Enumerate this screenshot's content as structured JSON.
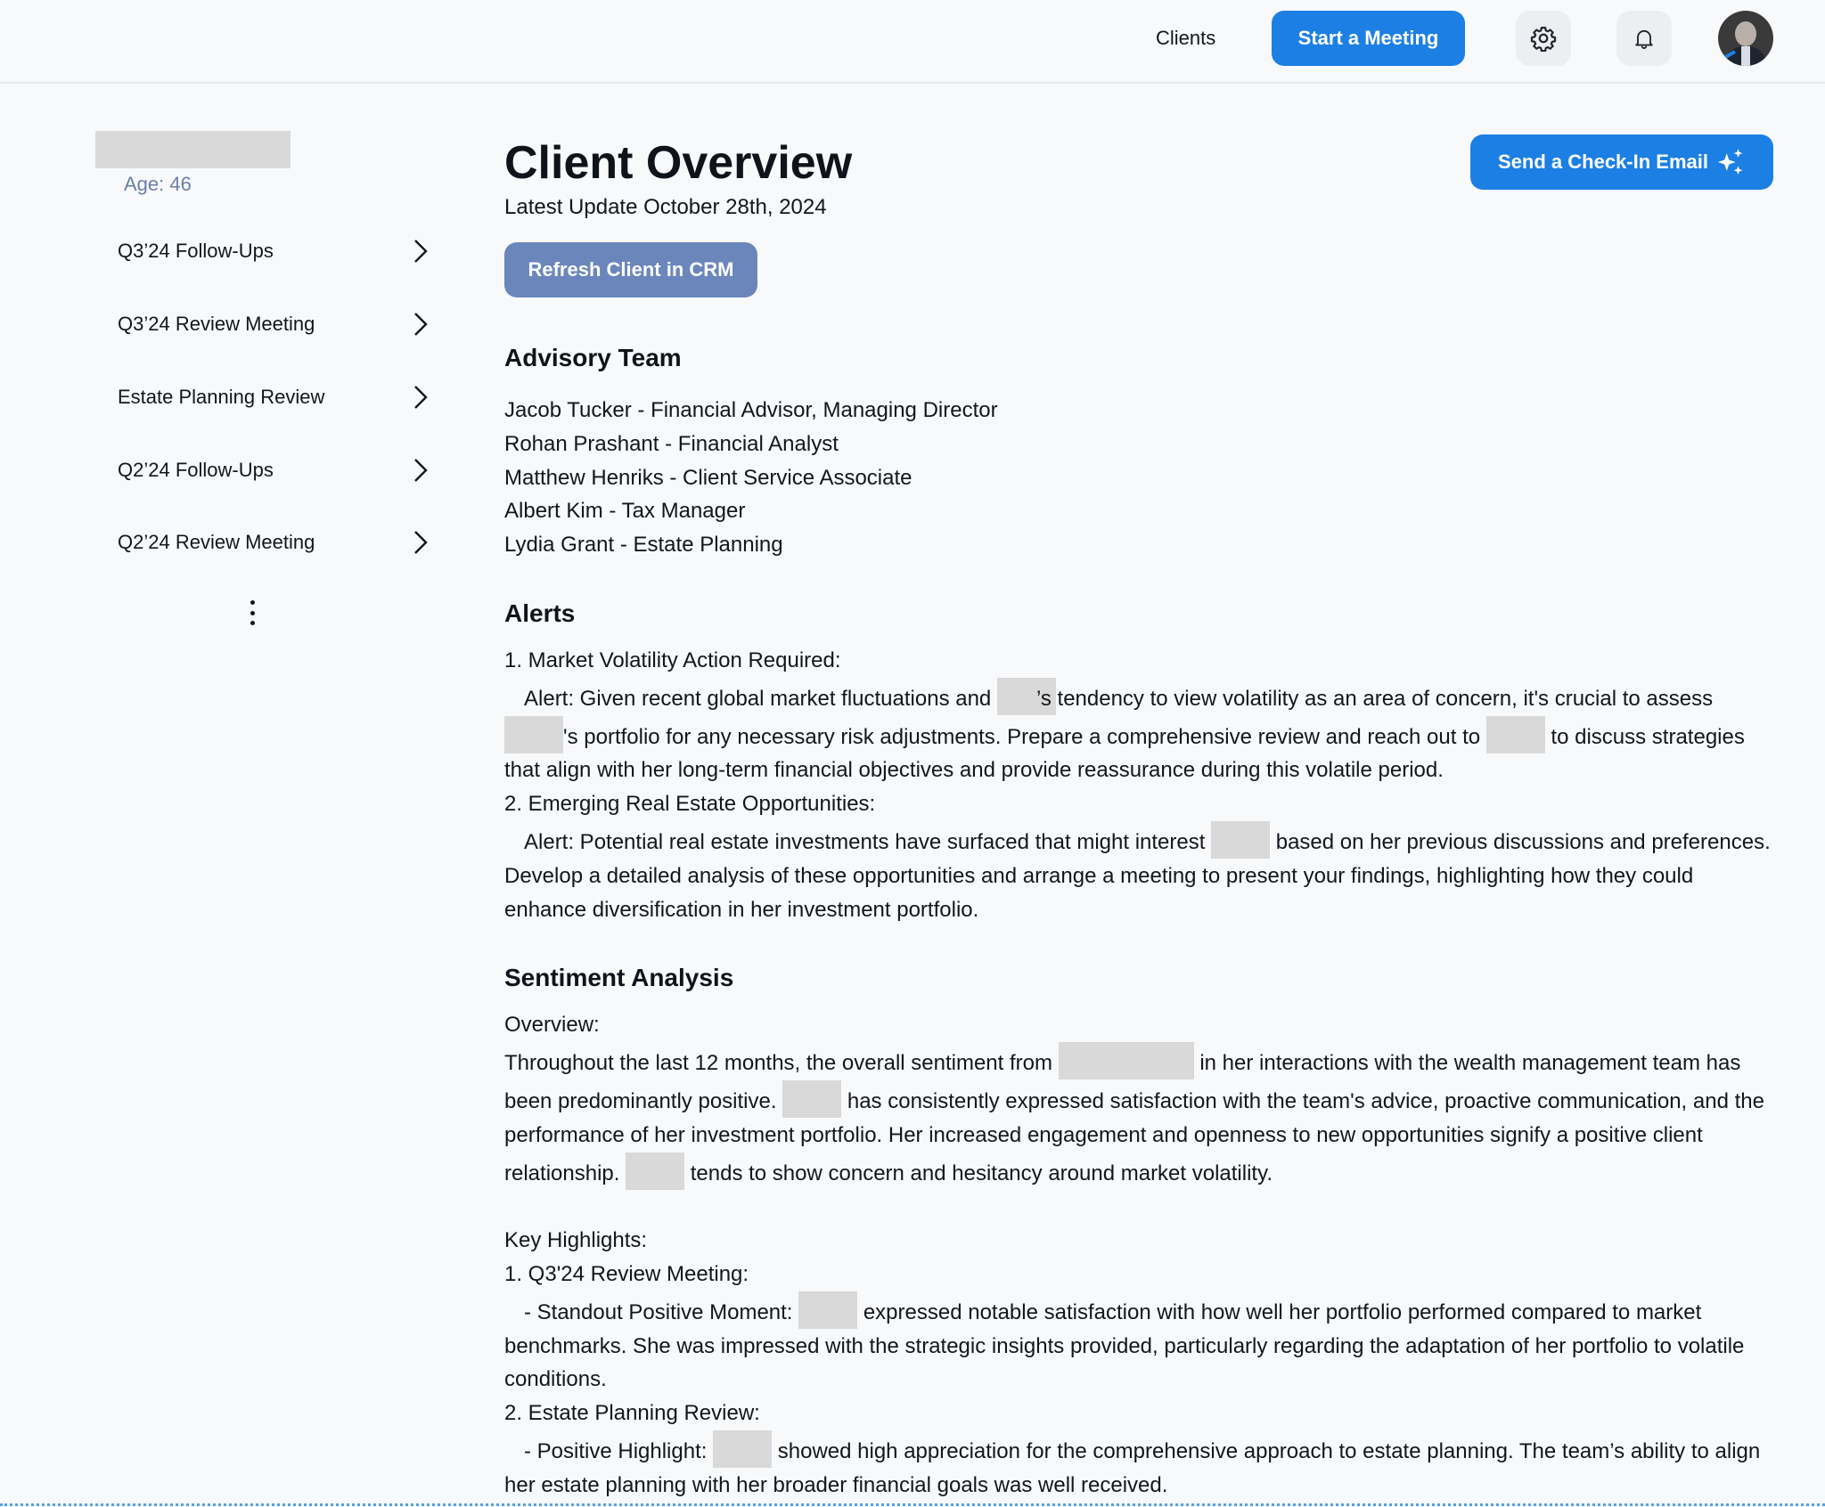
{
  "header": {
    "nav_clients": "Clients",
    "start_meeting_label": "Start a Meeting",
    "icons": {
      "settings": "gear-icon",
      "notifications": "bell-icon",
      "avatar": "user-avatar"
    },
    "colors": {
      "primary": "#1c7fe3",
      "icon_button_bg": "#eceef2"
    }
  },
  "sidebar": {
    "client_name": "",
    "age": "Age: 46",
    "items": [
      {
        "label": "Q3’24 Follow-Ups"
      },
      {
        "label": "Q3’24 Review Meeting"
      },
      {
        "label": "Estate Planning Review"
      },
      {
        "label": "Q2’24 Follow-Ups"
      },
      {
        "label": "Q2’24 Review Meeting"
      }
    ],
    "more_icon": "kebab-menu-icon"
  },
  "main": {
    "title": "Client Overview",
    "latest_update": "Latest Update October 28th, 2024",
    "refresh_label": "Refresh Client in CRM",
    "send_email_label": "Send a Check-In Email",
    "send_email_icon": "sparkles-icon",
    "colors": {
      "refresh_button": "#6b86bb",
      "send_button": "#1c7fe3"
    },
    "advisory_team": {
      "heading": "Advisory Team",
      "members": [
        "Jacob Tucker - Financial Advisor, Managing Director",
        "Rohan Prashant - Financial Analyst",
        "Matthew Henriks - Client Service Associate",
        "Albert Kim - Tax Manager",
        "Lydia Grant - Estate Planning"
      ]
    },
    "alerts": {
      "heading": "Alerts",
      "items": [
        {
          "title": "1. Market Volatility Action Required:",
          "t1": "Alert: Given recent global market fluctuations and ",
          "t2": "’s tendency to view volatility as an area of concern, it's crucial to assess ",
          "t3": "'s portfolio for any necessary risk adjustments. Prepare a comprehensive review and reach out to ",
          "t4": " to discuss strategies that align with her long-term financial objectives and provide reassurance during this volatile period."
        },
        {
          "title": "2. Emerging Real Estate Opportunities:",
          "t1": "Alert: Potential real estate investments have surfaced that might interest ",
          "t2": " based on her previous discussions and preferences. Develop a detailed analysis of these opportunities and arrange a meeting to present your findings, highlighting how they could enhance diversification in her investment portfolio."
        }
      ]
    },
    "sentiment": {
      "heading": "Sentiment Analysis",
      "overview_label": "Overview:",
      "o1": "Throughout the last 12 months, the overall sentiment from ",
      "o2": " in her interactions with the wealth management team has been predominantly positive. ",
      "o3": " has consistently expressed satisfaction with the team's advice, proactive communication, and the performance of her investment portfolio. Her increased engagement and openness to new opportunities signify a positive client relationship. ",
      "o4": " tends to show concern and hesitancy around market volatility.",
      "highlights_label": "Key Highlights:",
      "highlights": [
        {
          "title": "1. Q3'24 Review Meeting:",
          "t1": "- Standout Positive Moment: ",
          "t2": " expressed notable satisfaction with how well her portfolio performed compared to market benchmarks. She was impressed with the strategic insights provided, particularly regarding the adaptation of her portfolio to volatile conditions."
        },
        {
          "title": "2. Estate Planning Review:",
          "t1": "- Positive Highlight: ",
          "t2": " showed high appreciation for the comprehensive approach to estate planning. The team’s ability to align her estate planning with her broader financial goals was well received."
        }
      ]
    }
  }
}
